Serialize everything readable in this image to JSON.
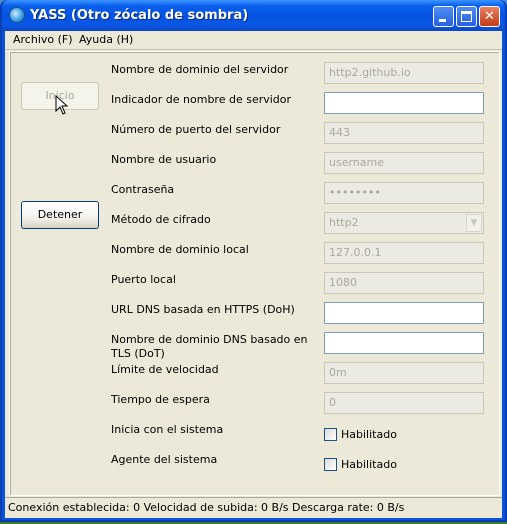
{
  "window": {
    "title": "YASS (Otro zócalo de sombra)"
  },
  "menubar": {
    "items": [
      {
        "label": "Archivo (F)"
      },
      {
        "label": "Ayuda (H)"
      }
    ]
  },
  "buttons": {
    "start_label": "Inicio",
    "stop_label": "Detener"
  },
  "form": {
    "rows": [
      {
        "label": "Nombre de dominio del servidor",
        "value": "http2.github.io"
      },
      {
        "label": "Indicador de nombre de servidor",
        "value": ""
      },
      {
        "label": "Número de puerto del servidor",
        "value": "443"
      },
      {
        "label": "Nombre de usuario",
        "value": "username"
      },
      {
        "label": "Contraseña",
        "value": "••••••••"
      },
      {
        "label": "Método de cifrado",
        "value": "http2"
      },
      {
        "label": "Nombre de dominio local",
        "value": "127.0.0.1"
      },
      {
        "label": "Puerto local",
        "value": "1080"
      },
      {
        "label": "URL DNS basada en HTTPS (DoH)",
        "value": ""
      },
      {
        "label": "Nombre de dominio DNS basado en TLS (DoT)",
        "value": ""
      },
      {
        "label": "Límite de velocidad",
        "value": "0m"
      },
      {
        "label": "Tiempo de espera",
        "value": "0"
      },
      {
        "label": "Inicia con el sistema",
        "checkbox_label": "Habilitado",
        "checked": false
      },
      {
        "label": "Agente del sistema",
        "checkbox_label": "Habilitado",
        "checked": false
      }
    ]
  },
  "status": {
    "text": "Conexión establecida: 0 Velocidad de subida: 0 B/s Descarga rate: 0 B/s"
  },
  "colors": {
    "titlebar": "#0553e0",
    "client_bg": "#ece9d8",
    "field_border": "#7f9db9",
    "disabled_text": "#aca899"
  }
}
